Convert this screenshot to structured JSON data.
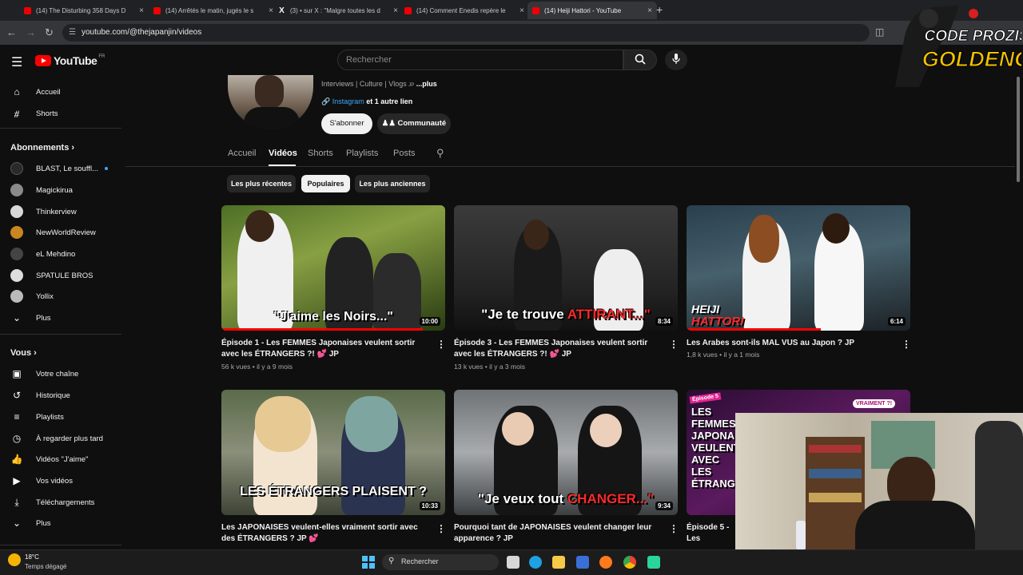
{
  "tabs": [
    {
      "title": "(14) The Disturbing 358 Days D",
      "icon": "youtube-icon"
    },
    {
      "title": "(14) Arrêtés le matin, jugés le s",
      "icon": "youtube-icon"
    },
    {
      "title": "(3) • sur X : \"Malgre toutes les d",
      "icon": "x-icon"
    },
    {
      "title": "(14) Comment Enedis repère le",
      "icon": "youtube-icon"
    },
    {
      "title": "(14) Heiji Hattori - YouTube",
      "icon": "youtube-icon",
      "active": true
    }
  ],
  "browser": {
    "url": "youtube.com/@thejapanjin/videos",
    "new_tab": "+",
    "close": "×"
  },
  "header": {
    "logo": "YouTube",
    "logo_region": "FR",
    "search_placeholder": "Rechercher"
  },
  "overlay_badge": {
    "line1": "CODE PROZIS",
    "line2": "GOLDENG"
  },
  "sidebar": {
    "main": [
      {
        "label": "Accueil",
        "icon": "home-icon"
      },
      {
        "label": "Shorts",
        "icon": "shorts-icon"
      }
    ],
    "subs_heading": "Abonnements",
    "subs": [
      {
        "label": "BLAST, Le souffl...",
        "color": "#2a2a2a",
        "new": true
      },
      {
        "label": "Magickirua",
        "color": "#8a8a8a"
      },
      {
        "label": "Thinkerview",
        "color": "#d8d8d8"
      },
      {
        "label": "NewWorldReview",
        "color": "#c9871f"
      },
      {
        "label": "eL Mehdino",
        "color": "#444"
      },
      {
        "label": "SPATULE BROS",
        "color": "#ddd"
      },
      {
        "label": "Yollix",
        "color": "#bbb"
      }
    ],
    "subs_more": "Plus",
    "you_heading": "Vous",
    "you": [
      {
        "label": "Votre chaîne",
        "icon": "channel-icon"
      },
      {
        "label": "Historique",
        "icon": "history-icon"
      },
      {
        "label": "Playlists",
        "icon": "playlists-icon"
      },
      {
        "label": "À regarder plus tard",
        "icon": "watch-later-icon"
      },
      {
        "label": "Vidéos \"J'aime\"",
        "icon": "like-icon"
      },
      {
        "label": "Vos vidéos",
        "icon": "your-videos-icon"
      },
      {
        "label": "Téléchargements",
        "icon": "download-icon"
      },
      {
        "label": "Plus",
        "icon": "chevron-down-icon"
      }
    ]
  },
  "channel": {
    "description": "Interviews | Culture | Vlogs",
    "description_more": "...plus",
    "link_label": "Instagram",
    "link_more": "et 1 autre lien",
    "subscribe": "S'abonner",
    "community": "Communauté",
    "tabs": [
      "Accueil",
      "Vidéos",
      "Shorts",
      "Playlists",
      "Posts"
    ],
    "active_tab": "Vidéos"
  },
  "chips": [
    "Les plus récentes",
    "Populaires",
    "Les plus anciennes"
  ],
  "active_chip": "Populaires",
  "videos": [
    {
      "title": "Épisode 1 - Les FEMMES Japonaises veulent sortir avec les ÉTRANGERS ?! 💕 JP",
      "views": "56 k vues",
      "age": "il y a 9 mois",
      "duration": "10:00",
      "caption": "\"J'aime les Noirs...\"",
      "progress": 0.9
    },
    {
      "title": "Épisode 3 - Les FEMMES Japonaises veulent sortir avec les ÉTRANGERS ?! 💕 JP",
      "views": "13 k vues",
      "age": "il y a 3 mois",
      "duration": "8:34",
      "caption_a": "\"Je te trouve ",
      "caption_b": "ATTIRANT...\"",
      "progress": 0.0
    },
    {
      "title": "Les Arabes sont-ils MAL VUS au Japon ? JP",
      "views": "1,8 k vues",
      "age": "il y a 1 mois",
      "duration": "6:14",
      "caption_a": "HEIJI",
      "caption_b": "HATTORI",
      "progress": 0.6
    },
    {
      "title": "Les JAPONAISES veulent-elles vraiment sortir avec des ÉTRANGERS ? JP 💕",
      "duration": "10:33",
      "caption": "LES ÉTRANGERS PLAISENT ?"
    },
    {
      "title": "Pourquoi tant de JAPONAISES veulent changer leur apparence ? JP",
      "duration": "9:34",
      "caption_a": "\"Je veux tout ",
      "caption_b": "CHANGER...\""
    },
    {
      "title": "Épisode 5 - Les FEMMES Japonaises veulent sortir avec les ÉTRANGERS ?!",
      "badge": "Épisode 5",
      "badge2": "VRAIMENT ?!",
      "thumb_text": "LES FEMMES JAPONAISES VEULENT... AVEC LES ÉTRANGERS"
    }
  ],
  "taskbar": {
    "temperature": "18°C",
    "weather": "Temps dégagé",
    "search": "Rechercher"
  }
}
